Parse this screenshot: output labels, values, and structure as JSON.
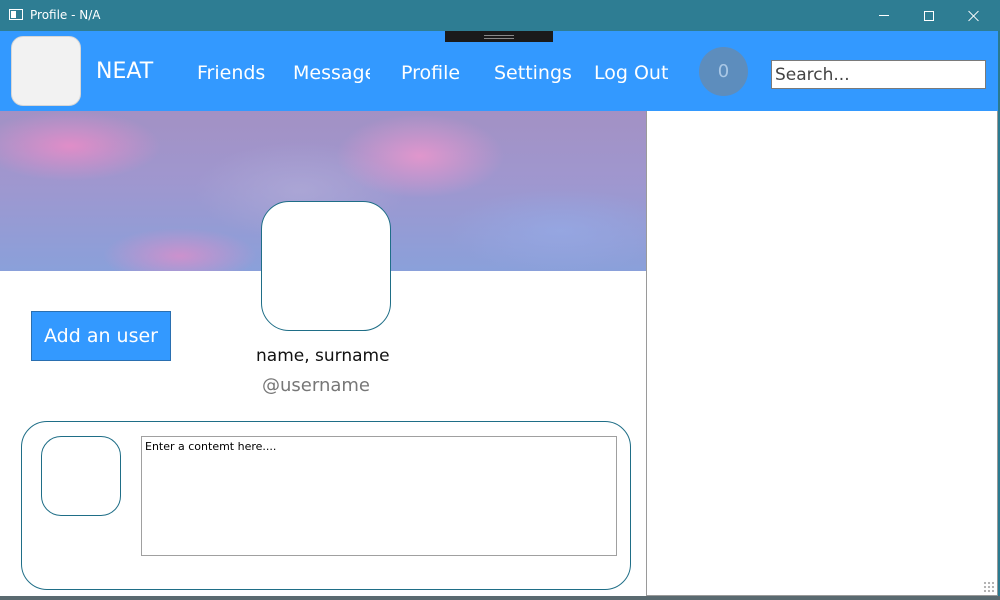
{
  "window": {
    "title": "Profile - N/A"
  },
  "navbar": {
    "brand": "NEAT",
    "links": [
      {
        "label": "Friends"
      },
      {
        "label": "Message"
      },
      {
        "label": "Profile"
      },
      {
        "label": "Settings"
      },
      {
        "label": "Log Out"
      }
    ],
    "notification_count": "0",
    "search_placeholder": "Search..."
  },
  "profile": {
    "add_user_label": "Add an user",
    "full_name": "name, surname",
    "username": "@username"
  },
  "composer": {
    "placeholder": "Enter a contemt here...."
  },
  "colors": {
    "nav_bg": "#3399ff",
    "title_bar": "#2e7d93",
    "accent_border": "#1f6e87",
    "badge_bg": "#5d8dbd"
  }
}
